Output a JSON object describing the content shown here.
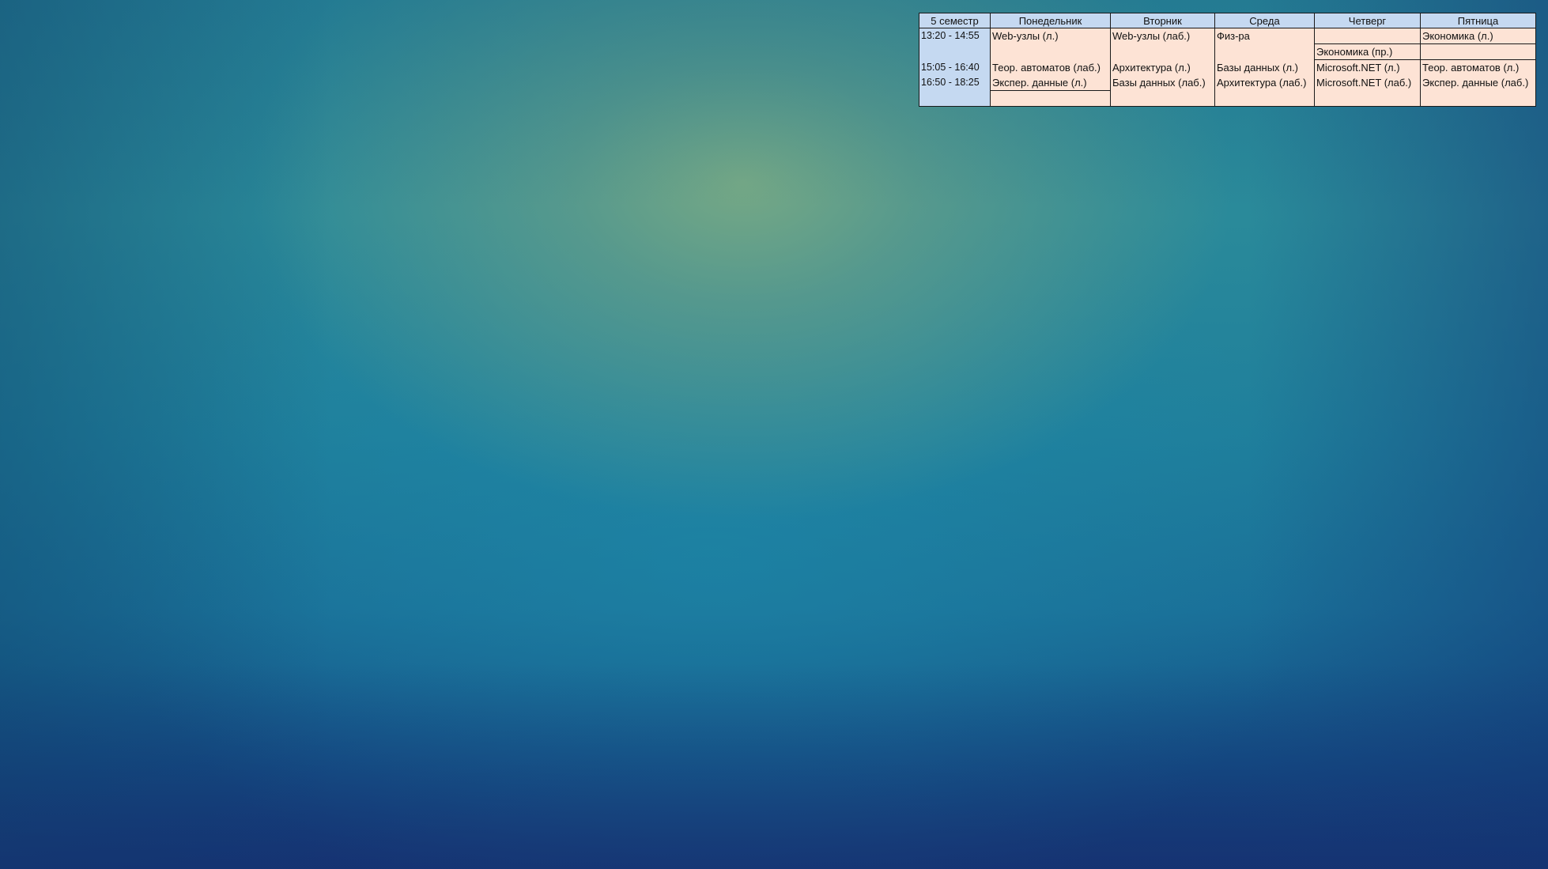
{
  "schedule": {
    "header": {
      "corner": "5 семестр",
      "days": [
        "Понедельник",
        "Вторник",
        "Среда",
        "Четверг",
        "Пятница"
      ]
    },
    "slots": [
      {
        "time": "13:20 - 14:55",
        "top": [
          "Web-узлы (л.)",
          "Web-узлы (лаб.)",
          "Физ-ра",
          "",
          "Экономика (л.)"
        ],
        "bottom": [
          "",
          "",
          "",
          "Экономика (пр.)",
          ""
        ]
      },
      {
        "time": "15:05 - 16:40",
        "top": [
          "Теор. автоматов (лаб.)",
          "Архитектура (л.)",
          "Базы данных (л.)",
          "Microsoft.NET (л.)",
          "Теор. автоматов (л.)"
        ],
        "bottom": [
          "",
          "",
          "",
          "",
          ""
        ]
      },
      {
        "time": "16:50 - 18:25",
        "top": [
          "Экспер. данные (л.)",
          "Базы данных (лаб.)",
          "Архитектура (лаб.)",
          "Microsoft.NET (лаб.)",
          "Экспер. данные (лаб.)"
        ],
        "bottom": [
          "",
          "",
          "",
          "",
          ""
        ]
      }
    ]
  }
}
